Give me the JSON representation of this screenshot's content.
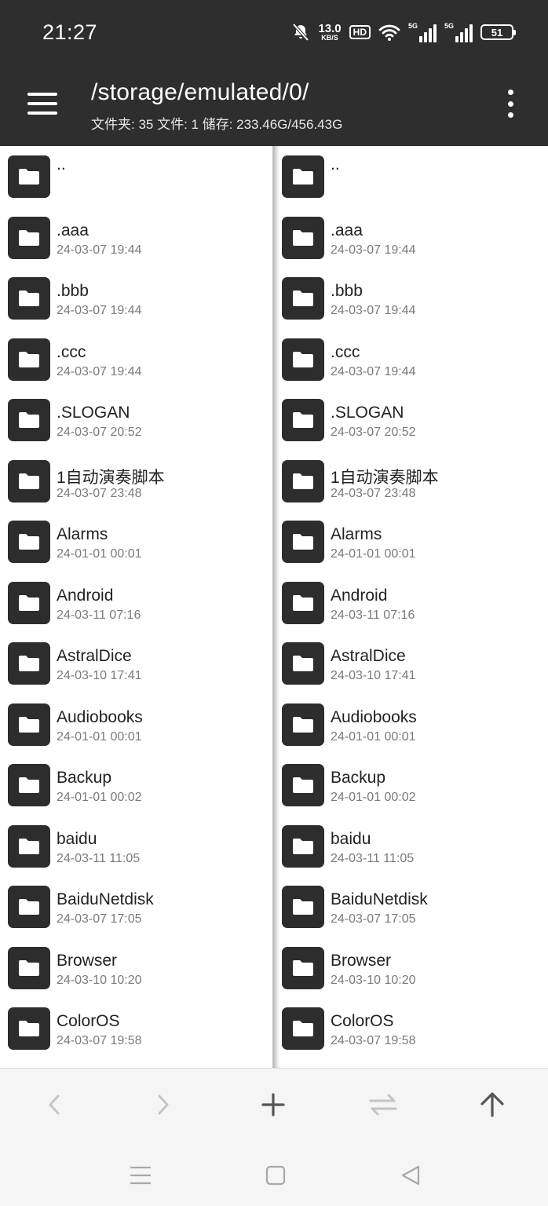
{
  "status_bar": {
    "time": "21:27",
    "net_speed_value": "13.0",
    "net_speed_unit": "KB/S",
    "hd_label": "HD",
    "signal1_label": "5G",
    "signal2_label": "5G",
    "battery_level": "51"
  },
  "header": {
    "path": "/storage/emulated/0/",
    "summary": "文件夹: 35  文件: 1  储存: 233.46G/456.43G"
  },
  "colors": {
    "header_bg": "#2e2e2e",
    "folder_tile": "#2d2d2d",
    "pane_bg": "#ffffff",
    "toolbar_icon": "#555555",
    "toolbar_icon_disabled": "#c4c4c4"
  },
  "icons": {
    "menu": "hamburger-icon",
    "more": "more-vertical-icon",
    "folder": "folder-icon",
    "back": "chevron-left-icon",
    "forward": "chevron-right-icon",
    "add": "plus-icon",
    "swap": "swap-icon",
    "up": "arrow-up-icon"
  },
  "left_pane": {
    "items": [
      {
        "name": "..",
        "date": ""
      },
      {
        "name": ".aaa",
        "date": "24-03-07 19:44"
      },
      {
        "name": ".bbb",
        "date": "24-03-07 19:44"
      },
      {
        "name": ".ccc",
        "date": "24-03-07 19:44"
      },
      {
        "name": ".SLOGAN",
        "date": "24-03-07 20:52"
      },
      {
        "name": "1自动演奏脚本",
        "date": "24-03-07 23:48"
      },
      {
        "name": "Alarms",
        "date": "24-01-01 00:01"
      },
      {
        "name": "Android",
        "date": "24-03-11 07:16"
      },
      {
        "name": "AstralDice",
        "date": "24-03-10 17:41"
      },
      {
        "name": "Audiobooks",
        "date": "24-01-01 00:01"
      },
      {
        "name": "Backup",
        "date": "24-01-01 00:02"
      },
      {
        "name": "baidu",
        "date": "24-03-11 11:05"
      },
      {
        "name": "BaiduNetdisk",
        "date": "24-03-07 17:05"
      },
      {
        "name": "Browser",
        "date": "24-03-10 10:20"
      },
      {
        "name": "ColorOS",
        "date": "24-03-07 19:58"
      }
    ]
  },
  "right_pane": {
    "items": [
      {
        "name": "..",
        "date": ""
      },
      {
        "name": ".aaa",
        "date": "24-03-07 19:44"
      },
      {
        "name": ".bbb",
        "date": "24-03-07 19:44"
      },
      {
        "name": ".ccc",
        "date": "24-03-07 19:44"
      },
      {
        "name": ".SLOGAN",
        "date": "24-03-07 20:52"
      },
      {
        "name": "1自动演奏脚本",
        "date": "24-03-07 23:48"
      },
      {
        "name": "Alarms",
        "date": "24-01-01 00:01"
      },
      {
        "name": "Android",
        "date": "24-03-11 07:16"
      },
      {
        "name": "AstralDice",
        "date": "24-03-10 17:41"
      },
      {
        "name": "Audiobooks",
        "date": "24-01-01 00:01"
      },
      {
        "name": "Backup",
        "date": "24-01-01 00:02"
      },
      {
        "name": "baidu",
        "date": "24-03-11 11:05"
      },
      {
        "name": "BaiduNetdisk",
        "date": "24-03-07 17:05"
      },
      {
        "name": "Browser",
        "date": "24-03-10 10:20"
      },
      {
        "name": "ColorOS",
        "date": "24-03-07 19:58"
      }
    ]
  }
}
